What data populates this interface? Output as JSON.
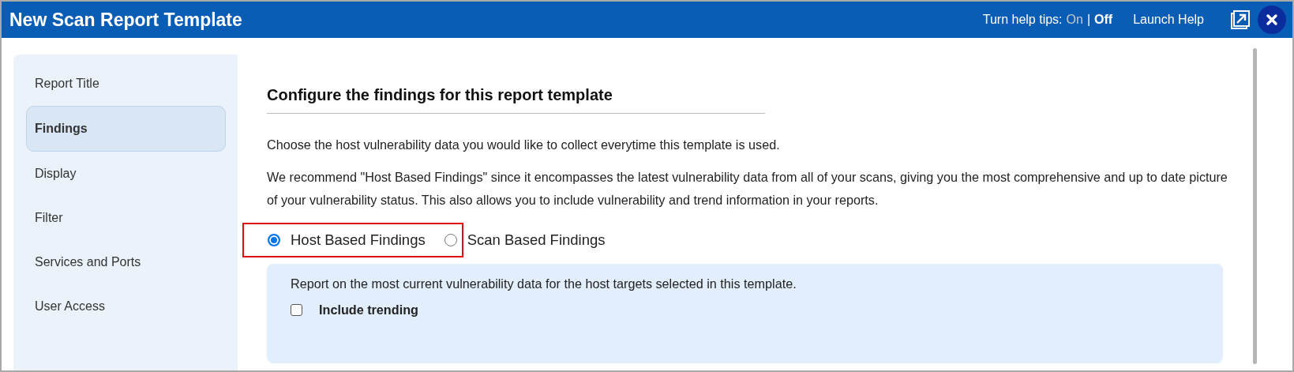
{
  "window": {
    "title": "New Scan Report Template"
  },
  "header": {
    "help_tips_label": "Turn help tips:",
    "help_tips_options": [
      {
        "label": "On",
        "selected": false
      },
      {
        "label": "Off",
        "selected": true
      }
    ],
    "separator": "|",
    "launch_help": "Launch Help"
  },
  "sidebar": {
    "items": [
      {
        "label": "Report Title",
        "selected": false
      },
      {
        "label": "Findings",
        "selected": true
      },
      {
        "label": "Display",
        "selected": false
      },
      {
        "label": "Filter",
        "selected": false
      },
      {
        "label": "Services and Ports",
        "selected": false
      },
      {
        "label": "User Access",
        "selected": false
      }
    ]
  },
  "main": {
    "heading": "Configure the findings for this report template",
    "paragraphs": [
      "Choose the host vulnerability data you would like to collect everytime this template is used.",
      "We recommend \"Host Based Findings\" since it encompasses the latest vulnerability data from all of your scans, giving you the most comprehensive and up to date picture of your vulnerability status. This also allows you to include vulnerability and trend information in your reports."
    ],
    "options_highlighted": true,
    "options": [
      {
        "label": "Host Based Findings",
        "selected": true
      },
      {
        "label": "Scan Based Findings",
        "selected": false
      }
    ],
    "detail": {
      "text": "Report on the most current vulnerability data for the host targets selected in this template.",
      "checkbox": {
        "label": "Include trending",
        "checked": false
      }
    }
  }
}
